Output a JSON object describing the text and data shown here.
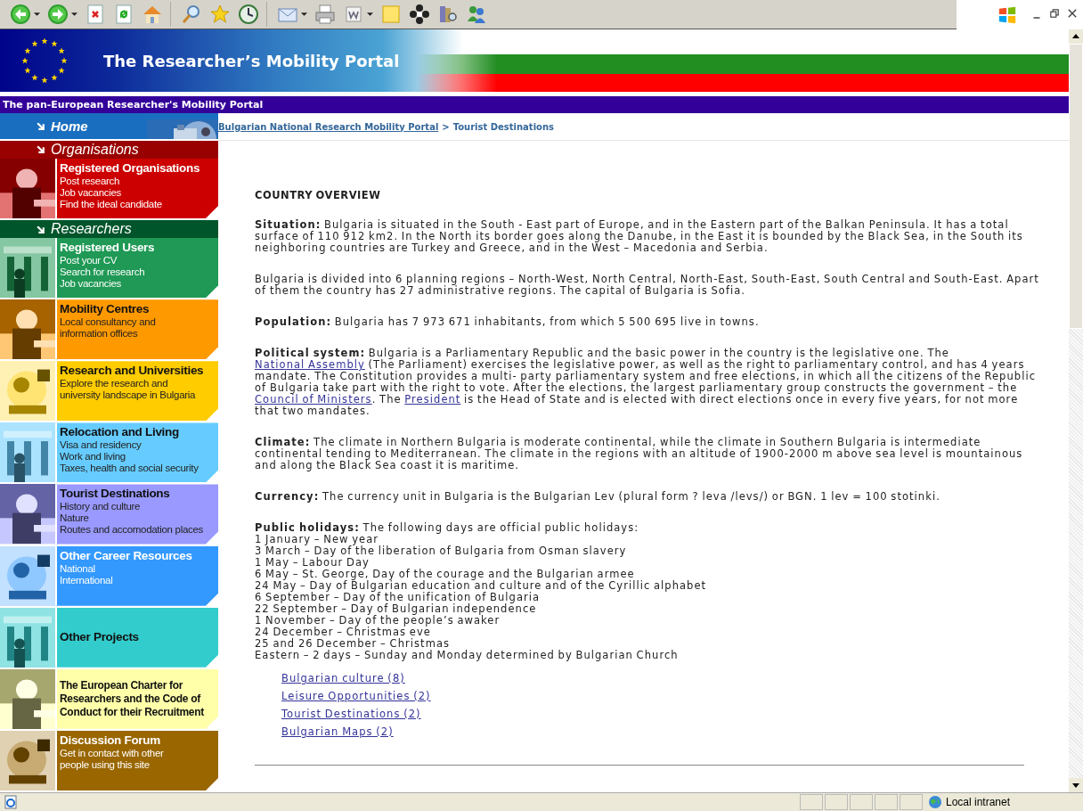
{
  "toolbar": [
    {
      "kind": "back",
      "dropdown": true
    },
    {
      "kind": "forward",
      "dropdown": true
    },
    {
      "kind": "stop",
      "dropdown": false
    },
    {
      "kind": "refresh",
      "dropdown": false
    },
    {
      "kind": "home",
      "dropdown": false
    },
    {
      "kind": "search",
      "dropdown": false
    },
    {
      "kind": "favorites",
      "dropdown": false
    },
    {
      "kind": "history",
      "dropdown": false
    },
    {
      "kind": "mail",
      "dropdown": true
    },
    {
      "kind": "print",
      "dropdown": false
    },
    {
      "kind": "edit",
      "dropdown": true
    },
    {
      "kind": "note",
      "dropdown": false
    },
    {
      "kind": "flower",
      "dropdown": false
    },
    {
      "kind": "research",
      "dropdown": false
    },
    {
      "kind": "messenger",
      "dropdown": false
    }
  ],
  "banner": {
    "title": "The Researcher’s Mobility Portal",
    "subtitle": "The pan-European Researcher's Mobility Portal"
  },
  "breadcrumb": {
    "link": "Bulgarian National Research Mobility Portal",
    "separator": ">",
    "current": "Tourist Destinations"
  },
  "sidebar": {
    "home": "Home",
    "items": [
      {
        "kind": "section",
        "title": "Organisations",
        "color": "#990000"
      },
      {
        "kind": "panel",
        "title": "Registered Organisations",
        "links": [
          "Post research",
          "Job vacancies",
          "Find the ideal candidate"
        ],
        "color": "#cc0000"
      },
      {
        "kind": "section",
        "title": "Researchers",
        "color": "#00552a"
      },
      {
        "kind": "panel",
        "title": "Registered Users",
        "links": [
          "Post your CV",
          "Search for research",
          "Job vacancies"
        ],
        "color": "#1f9955"
      },
      {
        "kind": "panel",
        "title": "Mobility Centres",
        "links": [
          "Local consultancy and",
          "information offices"
        ],
        "color": "#ff9900"
      },
      {
        "kind": "panel",
        "title": "Research and Universities",
        "links": [
          "Explore the research and",
          "university landscape in Bulgaria"
        ],
        "color": "#ffcc00"
      },
      {
        "kind": "panel",
        "title": "Relocation and Living",
        "links": [
          "Visa and residency",
          "Work and living",
          "Taxes, health and social security"
        ],
        "color": "#66ccff"
      },
      {
        "kind": "panel",
        "title": "Tourist Destinations",
        "links": [
          "History and culture",
          "Nature",
          "Routes and accomodation places"
        ],
        "color": "#9999ff"
      },
      {
        "kind": "panel",
        "title": "Other Career Resources",
        "links": [
          "National",
          "International"
        ],
        "color": "#3399ff"
      },
      {
        "kind": "panel",
        "title": "Other Projects",
        "color": "#33cccc"
      },
      {
        "kind": "panel",
        "title": "The European Charter for Researchers and the Code of Conduct for their Recruitment",
        "color": "#ffffaa"
      },
      {
        "kind": "panel",
        "title": "Discussion Forum",
        "links": [
          "Get in contact with other",
          "people using this site"
        ],
        "color": "#996600"
      }
    ]
  },
  "content": {
    "heading": "COUNTRY OVERVIEW",
    "paragraphs": [
      [
        {
          "kind": "label",
          "text": "Situation:"
        },
        {
          "kind": "text",
          "text": " Bulgaria is situated in the South - East part of Europe, and in the Eastern part of the Balkan Peninsula. It has a total surface of 110 912 km2. In the North its border goes along the Danube, in the East it is bounded by the Black Sea, in the South its neighboring countries are Turkey and Greece, and in the West – Macedonia and Serbia."
        }
      ],
      [
        {
          "kind": "text",
          "text": "Bulgaria is divided into 6 planning regions – North-West, North Central, North-East, South-East, South Central and South-East. Apart of them the country has 27 administrative regions. The capital of Bulgaria is Sofia."
        }
      ],
      [
        {
          "kind": "label",
          "text": "Population:"
        },
        {
          "kind": "text",
          "text": " Bulgaria has 7 973 671 inhabitants, from which 5 500 695 live in towns."
        }
      ],
      [
        {
          "kind": "label",
          "text": "Political system:"
        },
        {
          "kind": "text",
          "text": " Bulgaria is a Parliamentary Republic and the basic power in the country is the legislative one. The "
        },
        {
          "kind": "link",
          "text": "National Assembly"
        },
        {
          "kind": "text",
          "text": " (The Parliament) exercises the legislative power, as well as the right to parliamentary control, and has 4 years mandate. The Constitution provides a multi- party parliamentary system and free elections, in which all the citizens of the Republic of Bulgaria take part with the right to vote. After the elections, the largest parliamentary group constructs the government – the "
        },
        {
          "kind": "link",
          "text": "Council of Ministers"
        },
        {
          "kind": "text",
          "text": ". The "
        },
        {
          "kind": "link",
          "text": "President"
        },
        {
          "kind": "text",
          "text": " is the Head of State and is elected with direct elections once in every five years, for not more that two mandates."
        }
      ],
      [
        {
          "kind": "label",
          "text": "Climate:"
        },
        {
          "kind": "text",
          "text": " The climate in Northern Bulgaria is moderate continental, while the climate in Southern Bulgaria is intermediate continental tending to Mediterranean. The climate in the regions with an altitude of 1900-2000 m above sea level is mountainous and along the Black Sea coast it is maritime."
        }
      ],
      [
        {
          "kind": "label",
          "text": "Currency:"
        },
        {
          "kind": "text",
          "text": " The currency unit in Bulgaria is the Bulgarian Lev (plural form ? leva /levs/) or BGN. 1 lev = 100 stotinki."
        }
      ]
    ],
    "holidays": {
      "label": "Public holidays:",
      "text": " The following days are official public holidays:",
      "items": [
        "1 January – New year",
        "3 March – Day of the liberation of Bulgaria from Osman slavery",
        "1 May – Labour Day",
        "6 May – St. George, Day of the courage and the Bulgarian armee",
        "24 May – Day of Bulgarian education and culture and of the Cyrillic alphabet",
        "6 September – Day of the unification of Bulgaria",
        "22 September – Day of Bulgarian independence",
        "1 November – Day of the people’s awaker",
        "24 December – Christmas eve",
        "25 and 26 December – Christmas",
        "Eastern – 2 days – Sunday and Monday determined by Bulgarian Church"
      ]
    },
    "related_links": [
      "Bulgarian culture (8)",
      "Leisure Opportunities (2)",
      "Tourist Destinations (2)",
      "Bulgarian Maps (2)"
    ]
  },
  "status_bar": {
    "zone": "Local intranet"
  }
}
